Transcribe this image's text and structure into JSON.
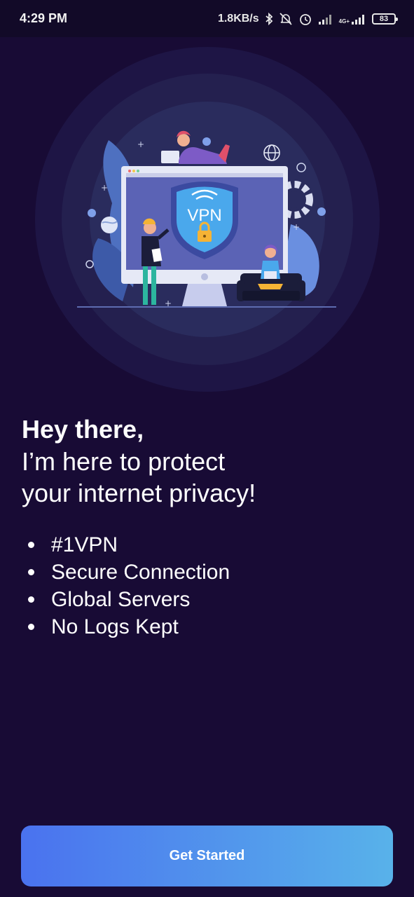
{
  "status_bar": {
    "time": "4:29 PM",
    "speed": "1.8KB/s",
    "network_label": "4G+",
    "battery": "83"
  },
  "hero": {
    "shield_label": "VPN"
  },
  "intro": {
    "greeting": "Hey there,",
    "line1": "I’m here to protect",
    "line2": "your internet privacy!"
  },
  "features": [
    "#1VPN",
    "Secure Connection",
    "Global Servers",
    "No Logs Kept"
  ],
  "cta": {
    "label": "Get Started"
  },
  "colors": {
    "background": "#180b35",
    "button_start": "#4a72ef",
    "button_end": "#58b2ea"
  }
}
